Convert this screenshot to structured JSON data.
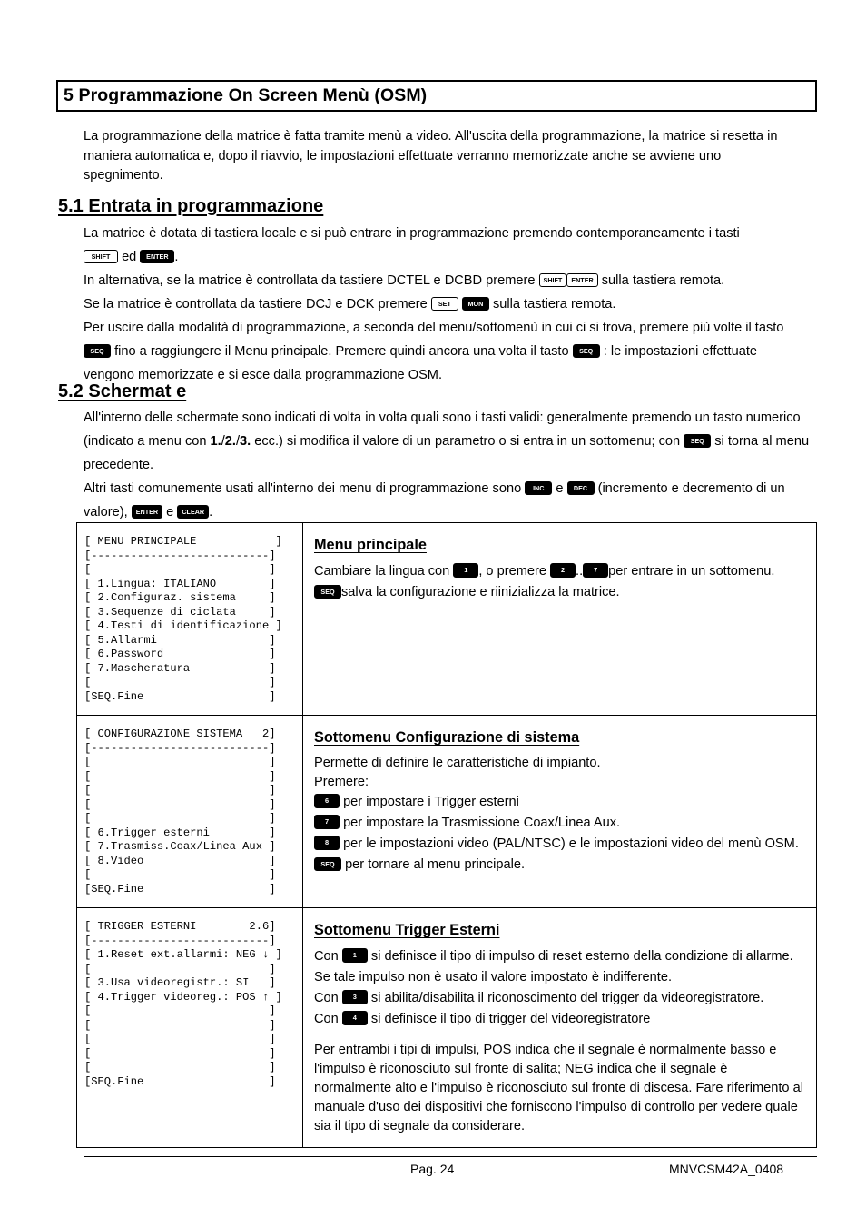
{
  "chapter": {
    "title": "5 Programmazione On Screen Menù (OSM)"
  },
  "intro": "La programmazione della matrice è fatta tramite menù a video. All'uscita della programmazione, la matrice si resetta in maniera automatica e, dopo il riavvio, le impostazioni effettuate verranno memorizzate anche se avviene uno spegnimento.",
  "section_51": {
    "heading": "5.1 Entrata in  programmazione",
    "p1_a": "La matrice è dotata di tastiera locale e si può entrare in programmazione premendo contemporaneamente i tasti",
    "p1_b": "ed",
    "p1_c": ".",
    "p2_a": "In alternativa, se la matrice è controllata da tastiere DCTEL e DCBD premere",
    "p2_b": "sulla tastiera remota.",
    "p3_a": "Se la matrice è controllata da tastiere DCJ e DCK premere",
    "p3_b": "sulla tastiera remota.",
    "p4_a": "Per uscire dalla modalità di programmazione, a seconda del menu/sottomenù in cui ci si trova, premere più volte il tasto",
    "p4_b": "fino a raggiungere il Menu principale. Premere quindi ancora una volta il tasto",
    "p4_c": ": le impostazioni effettuate vengono memorizzate e si esce dalla programmazione OSM."
  },
  "section_52": {
    "heading": "5.2 Schermat e",
    "p1_a": "All'interno delle schermate sono indicati di volta in volta quali sono i tasti validi: generalmente premendo un tasto numerico (indicato a menu con",
    "num1": "1.",
    "sep1": "/",
    "num2": "2.",
    "sep2": "/",
    "num3": "3.",
    "p1_b": "ecc.) si modifica il valore di un parametro o si entra in un sottomenu; con",
    "p1_c": "si torna al menu precedente.",
    "p2_a": "Altri tasti comunemente usati all'interno dei menu di programmazione sono",
    "p2_b": "e",
    "p2_c": "(incremento e decremento di un valore),",
    "p2_d": "e",
    "p2_e": "."
  },
  "keys": {
    "shift": "SHIFT",
    "enter": "ENTER",
    "set": "SET",
    "mon": "MON",
    "seq": "SEQ",
    "inc": "INC",
    "dec": "DEC",
    "clear": "CLEAR",
    "k1": "1",
    "k2": "2",
    "k3": "3",
    "k4": "4",
    "k6": "6",
    "k7": "7",
    "k8": "8"
  },
  "screens": [
    {
      "osm": "[ MENU PRINCIPALE            ]\n[---------------------------]\n[                           ]\n[ 1.Lingua: ITALIANO        ]\n[ 2.Configuraz. sistema     ]\n[ 3.Sequenze di ciclata     ]\n[ 4.Testi di identificazione ]\n[ 5.Allarmi                 ]\n[ 6.Password                ]\n[ 7.Mascheratura            ]\n[                           ]\n[SEQ.Fine                   ]",
      "heading": "Menu principale",
      "line1_a": "Cambiare la lingua con",
      "line1_b": ", o premere",
      "line1_c": "..",
      "line1_d": "per entrare in un sottomenu.",
      "line2": "salva la configurazione e riinizializza la matrice."
    },
    {
      "osm": "[ CONFIGURAZIONE SISTEMA   2]\n[---------------------------]\n[                           ]\n[                           ]\n[                           ]\n[                           ]\n[                           ]\n[ 6.Trigger esterni         ]\n[ 7.Trasmiss.Coax/Linea Aux ]\n[ 8.Video                   ]\n[                           ]\n[SEQ.Fine                   ]",
      "heading": "Sottomenu Configurazione di sistema",
      "intro1": "Permette di definire le caratteristiche di impianto.",
      "intro2": "Premere:",
      "item6": "per impostare i Trigger esterni",
      "item7": "per impostare la Trasmissione Coax/Linea Aux.",
      "item8": "per le impostazioni video (PAL/NTSC) e le impostazioni video del menù OSM.",
      "itemseq": "per tornare al menu principale."
    },
    {
      "osm": "[ TRIGGER ESTERNI        2.6]\n[---------------------------]\n[ 1.Reset ext.allarmi: NEG ↓ ]\n[                           ]\n[ 3.Usa videoregistr.: SI   ]\n[ 4.Trigger videoreg.: POS ↑ ]\n[                           ]\n[                           ]\n[                           ]\n[                           ]\n[                           ]\n[SEQ.Fine                   ]",
      "heading": "Sottomenu Trigger Esterni",
      "con": "Con",
      "item1": "si definisce il tipo di impulso di reset esterno della condizione di allarme. Se tale impulso non è usato il valore impostato è indifferente.",
      "item3": "si abilita/disabilita il riconoscimento del trigger da videoregistratore.",
      "item4": "si definisce il tipo di trigger del videoregistratore",
      "note": "Per entrambi i tipi di impulsi, POS indica che il segnale  è normalmente basso e l'impulso  è riconosciuto sul fronte di salita; NEG indica che il segnale è normalmente alto e l'impulso  è riconosciuto sul fronte di discesa. Fare riferimento al manuale d'uso dei dispositivi che forniscono l'impulso di controllo per vedere quale sia il tipo di segnale da considerare."
    }
  ],
  "footer": {
    "page": "Pag. 24",
    "code": "MNVCSM42A_0408"
  }
}
